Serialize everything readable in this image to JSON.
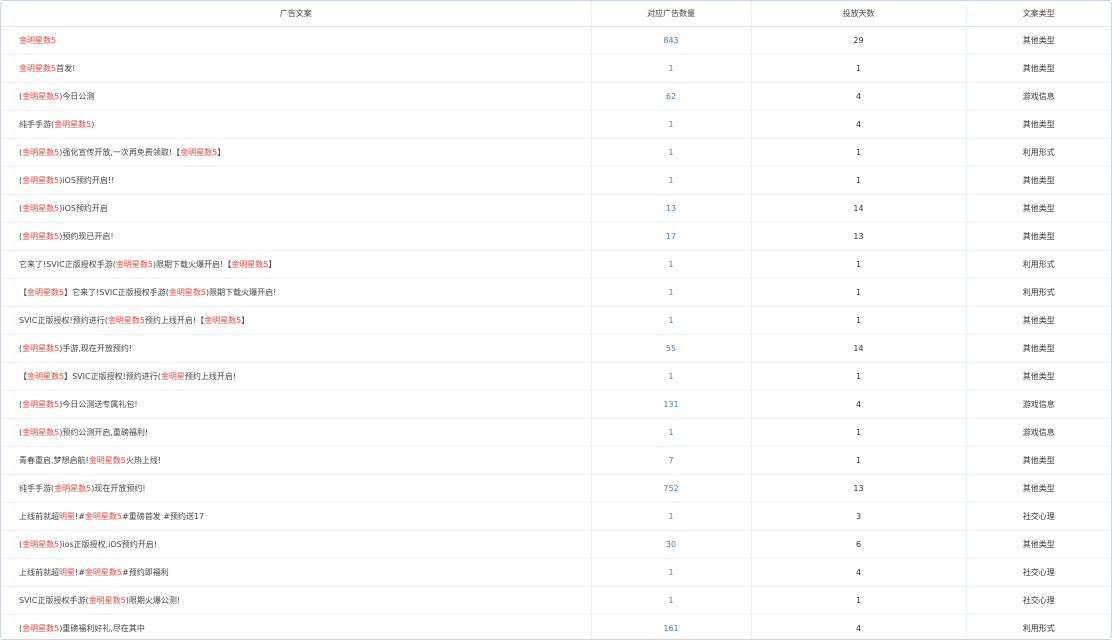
{
  "theme": {
    "keyword_color": "#e8483b",
    "count_color": "#3a7fd0"
  },
  "headers": [
    "广告文案",
    "对应广告数量",
    "投放天数",
    "文案类型"
  ],
  "rows": [
    {
      "segments": [
        {
          "t": "金明星数5",
          "k": true
        }
      ],
      "count": "843",
      "days": "29",
      "type": "其他类型"
    },
    {
      "segments": [
        {
          "t": "金明星数5",
          "k": true
        },
        {
          "t": "首发!",
          "k": false
        }
      ],
      "count": "1",
      "days": "1",
      "type": "其他类型"
    },
    {
      "segments": [
        {
          "t": "(",
          "k": false
        },
        {
          "t": "金明星数5",
          "k": true
        },
        {
          "t": ")今日公测",
          "k": false
        }
      ],
      "count": "62",
      "days": "4",
      "type": "游戏信息"
    },
    {
      "segments": [
        {
          "t": "纯手手游(",
          "k": false
        },
        {
          "t": "金明星数5",
          "k": true
        },
        {
          "t": ")",
          "k": false
        }
      ],
      "count": "1",
      "days": "4",
      "type": "其他类型"
    },
    {
      "segments": [
        {
          "t": "(",
          "k": false
        },
        {
          "t": "金明星数5",
          "k": true
        },
        {
          "t": ")强化宣传开放,一次再免费领取!【",
          "k": false
        },
        {
          "t": "金明星数5",
          "k": true
        },
        {
          "t": "】",
          "k": false
        }
      ],
      "count": "1",
      "days": "1",
      "type": "利用形式"
    },
    {
      "segments": [
        {
          "t": "(",
          "k": false
        },
        {
          "t": "金明星数5",
          "k": true
        },
        {
          "t": ")iOS预约开启!!",
          "k": false
        }
      ],
      "count": "1",
      "days": "1",
      "type": "其他类型"
    },
    {
      "segments": [
        {
          "t": "(",
          "k": false
        },
        {
          "t": "金明星数5",
          "k": true
        },
        {
          "t": ")iOS预约开启",
          "k": false
        }
      ],
      "count": "13",
      "days": "14",
      "type": "其他类型"
    },
    {
      "segments": [
        {
          "t": "(",
          "k": false
        },
        {
          "t": "金明星数5",
          "k": true
        },
        {
          "t": ")预约现已开启!",
          "k": false
        }
      ],
      "count": "17",
      "days": "13",
      "type": "其他类型"
    },
    {
      "segments": [
        {
          "t": "它来了!SVIC正版授权手游(",
          "k": false
        },
        {
          "t": "金明星数5",
          "k": true
        },
        {
          "t": ")限期下载火爆开启!【",
          "k": false
        },
        {
          "t": "金明星数5",
          "k": true
        },
        {
          "t": "】",
          "k": false
        }
      ],
      "count": "1",
      "days": "1",
      "type": "利用形式"
    },
    {
      "segments": [
        {
          "t": "【",
          "k": false
        },
        {
          "t": "金明星数5",
          "k": true
        },
        {
          "t": "】它来了!SVIC正版授权手游(",
          "k": false
        },
        {
          "t": "金明星数5",
          "k": true
        },
        {
          "t": ")限期下载火爆开启!",
          "k": false
        }
      ],
      "count": "1",
      "days": "1",
      "type": "利用形式"
    },
    {
      "segments": [
        {
          "t": "SVIC正版授权!预约进行(",
          "k": false
        },
        {
          "t": "金明星数5",
          "k": true
        },
        {
          "t": "预约上线开启!【",
          "k": false
        },
        {
          "t": "金明星数5",
          "k": true
        },
        {
          "t": "】",
          "k": false
        }
      ],
      "count": "1",
      "days": "1",
      "type": "其他类型"
    },
    {
      "segments": [
        {
          "t": "(",
          "k": false
        },
        {
          "t": "金明星数5",
          "k": true
        },
        {
          "t": ")手游,现在开放预约!",
          "k": false
        }
      ],
      "count": "55",
      "days": "14",
      "type": "其他类型"
    },
    {
      "segments": [
        {
          "t": "【",
          "k": false
        },
        {
          "t": "金明星数5",
          "k": true
        },
        {
          "t": "】SVIC正版授权!预约进行(",
          "k": false
        },
        {
          "t": "金明星",
          "k": true
        },
        {
          "t": "预约上线开启!",
          "k": false
        }
      ],
      "count": "1",
      "days": "1",
      "type": "其他类型"
    },
    {
      "segments": [
        {
          "t": "(",
          "k": false
        },
        {
          "t": "金明星数5",
          "k": true
        },
        {
          "t": ")今日公测送专属礼包!",
          "k": false
        }
      ],
      "count": "131",
      "days": "4",
      "type": "游戏信息"
    },
    {
      "segments": [
        {
          "t": "(",
          "k": false
        },
        {
          "t": "金明星数5",
          "k": true
        },
        {
          "t": ")预约公测开启,重磅福利!",
          "k": false
        }
      ],
      "count": "1",
      "days": "1",
      "type": "游戏信息"
    },
    {
      "segments": [
        {
          "t": "青春重启,梦想启航!",
          "k": false
        },
        {
          "t": "金明星数5",
          "k": true
        },
        {
          "t": "火热上线!",
          "k": false
        }
      ],
      "count": "7",
      "days": "1",
      "type": "其他类型"
    },
    {
      "segments": [
        {
          "t": "纯手手游(",
          "k": false
        },
        {
          "t": "金明星数5",
          "k": true
        },
        {
          "t": ")现在开放预约!",
          "k": false
        }
      ],
      "count": "752",
      "days": "13",
      "type": "其他类型"
    },
    {
      "segments": [
        {
          "t": "上线前就超",
          "k": false
        },
        {
          "t": "明星",
          "k": true
        },
        {
          "t": "!#",
          "k": false
        },
        {
          "t": "金明星数5",
          "k": true
        },
        {
          "t": "#重磅首发 #预约送17",
          "k": false
        }
      ],
      "count": "1",
      "days": "3",
      "type": "社交心理"
    },
    {
      "segments": [
        {
          "t": "(",
          "k": false
        },
        {
          "t": "金明星数5",
          "k": true
        },
        {
          "t": ")ios正版授权,iOS预约开启!",
          "k": false
        }
      ],
      "count": "30",
      "days": "6",
      "type": "其他类型"
    },
    {
      "segments": [
        {
          "t": "上线前就超",
          "k": false
        },
        {
          "t": "明星",
          "k": true
        },
        {
          "t": "!#",
          "k": false
        },
        {
          "t": "金明星数5",
          "k": true
        },
        {
          "t": "#预约即福利",
          "k": false
        }
      ],
      "count": "1",
      "days": "4",
      "type": "社交心理"
    },
    {
      "segments": [
        {
          "t": "SVIC正版授权手游(",
          "k": false
        },
        {
          "t": "金明星数5",
          "k": true
        },
        {
          "t": ")限期火爆公测!",
          "k": false
        }
      ],
      "count": "1",
      "days": "1",
      "type": "社交心理"
    },
    {
      "segments": [
        {
          "t": "(",
          "k": false
        },
        {
          "t": "金明星数5",
          "k": true
        },
        {
          "t": ")重磅福利好礼,尽在其中",
          "k": false
        }
      ],
      "count": "161",
      "days": "4",
      "type": "利用形式"
    }
  ]
}
